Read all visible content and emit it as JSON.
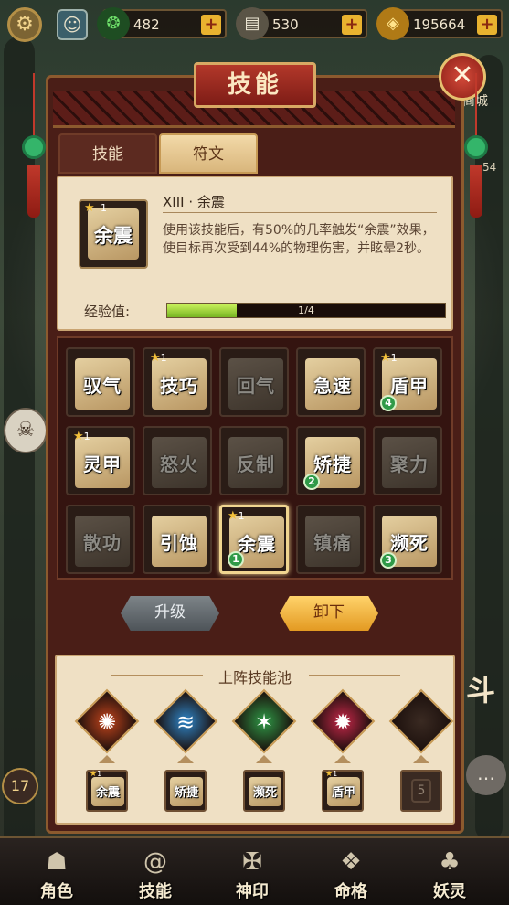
{
  "resources": [
    {
      "icon": "jade-drop-icon",
      "glyph": "❂",
      "value": "482",
      "color": "#3fb24f"
    },
    {
      "icon": "book-icon",
      "glyph": "▤",
      "value": "530",
      "color": "#d9d1b8"
    },
    {
      "icon": "coin-icon",
      "glyph": "◈",
      "value": "195664",
      "color": "#e9b22f"
    }
  ],
  "plus_label": "+",
  "close_label": "✕",
  "title": "技能",
  "side_label": "商城",
  "side_label2": "54",
  "tabs": [
    {
      "label": "技能",
      "active": false
    },
    {
      "label": "符文",
      "active": true
    }
  ],
  "selected_rune": {
    "level": "1",
    "icon_text": "余震",
    "name": "XIII · 余震",
    "description": "使用该技能后，有50%的几率触发“余震”效果，使目标再次受到44%的物理伤害，并眩晕2秒。",
    "exp_label": "经验值:",
    "exp_text": "1/4",
    "exp_fraction": 0.25
  },
  "runes": [
    {
      "text": "驭气",
      "star": false,
      "level": "",
      "count": "",
      "locked": false,
      "selected": false
    },
    {
      "text": "技巧",
      "star": true,
      "level": "1",
      "count": "",
      "locked": false,
      "selected": false
    },
    {
      "text": "回气",
      "star": false,
      "level": "",
      "count": "",
      "locked": true,
      "selected": false
    },
    {
      "text": "急速",
      "star": false,
      "level": "",
      "count": "",
      "locked": false,
      "selected": false
    },
    {
      "text": "盾甲",
      "star": true,
      "level": "1",
      "count": "4",
      "locked": false,
      "selected": false
    },
    {
      "text": "灵甲",
      "star": true,
      "level": "1",
      "count": "",
      "locked": false,
      "selected": false
    },
    {
      "text": "怒火",
      "star": false,
      "level": "",
      "count": "",
      "locked": true,
      "selected": false
    },
    {
      "text": "反制",
      "star": false,
      "level": "",
      "count": "",
      "locked": true,
      "selected": false
    },
    {
      "text": "矫捷",
      "star": false,
      "level": "",
      "count": "2",
      "locked": false,
      "selected": false
    },
    {
      "text": "聚力",
      "star": false,
      "level": "",
      "count": "",
      "locked": true,
      "selected": false
    },
    {
      "text": "散功",
      "star": false,
      "level": "",
      "count": "",
      "locked": true,
      "selected": false
    },
    {
      "text": "引蚀",
      "star": false,
      "level": "",
      "count": "",
      "locked": false,
      "selected": false
    },
    {
      "text": "余震",
      "star": true,
      "level": "1",
      "count": "1",
      "locked": false,
      "selected": true
    },
    {
      "text": "镇痛",
      "star": false,
      "level": "",
      "count": "",
      "locked": true,
      "selected": false
    },
    {
      "text": "濒死",
      "star": false,
      "level": "",
      "count": "3",
      "locked": false,
      "selected": false
    }
  ],
  "buttons": {
    "upgrade": "升级",
    "unload": "卸下"
  },
  "pool": {
    "title": "上阵技能池",
    "skills": [
      {
        "icon": "fire-dragon-icon",
        "glyph": "✺",
        "color": "#c4451c"
      },
      {
        "icon": "water-wave-icon",
        "glyph": "≋",
        "color": "#2f86c9"
      },
      {
        "icon": "wind-slash-icon",
        "glyph": "✶",
        "color": "#2f9a47"
      },
      {
        "icon": "blood-flame-icon",
        "glyph": "✹",
        "color": "#c8284a"
      },
      {
        "icon": "empty-skill-icon",
        "glyph": "",
        "color": "#3a2a22"
      }
    ],
    "slots": [
      {
        "text": "余震",
        "star": true,
        "level": "1"
      },
      {
        "text": "矫捷",
        "star": false,
        "level": ""
      },
      {
        "text": "濒死",
        "star": false,
        "level": ""
      },
      {
        "text": "盾甲",
        "star": true,
        "level": "1"
      },
      {
        "empty": true,
        "num": "5"
      }
    ]
  },
  "side_badge": "17",
  "fight_glyph": "斗",
  "nav": [
    {
      "label": "角色",
      "icon": "fox-mask-icon",
      "glyph": "☗"
    },
    {
      "label": "技能",
      "icon": "spiral-icon",
      "glyph": "@"
    },
    {
      "label": "神印",
      "icon": "seal-icon",
      "glyph": "✠"
    },
    {
      "label": "命格",
      "icon": "fate-icon",
      "glyph": "❖"
    },
    {
      "label": "妖灵",
      "icon": "spirit-icon",
      "glyph": "♣"
    }
  ]
}
